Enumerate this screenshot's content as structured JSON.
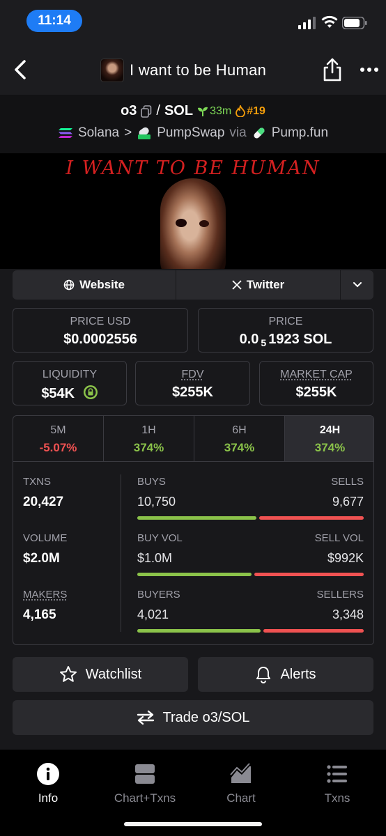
{
  "status": {
    "time": "11:14"
  },
  "nav": {
    "title": "I want to be Human"
  },
  "pair": {
    "base": "o3",
    "separator": "/",
    "quote": "SOL",
    "age": "33m",
    "rank": "#19",
    "chain": "Solana",
    "chevron": ">",
    "dex": "PumpSwap",
    "via": "via",
    "launchpad": "Pump.fun"
  },
  "banner": {
    "title": "I WANT TO BE HUMAN"
  },
  "links": {
    "website": "Website",
    "twitter": "Twitter"
  },
  "cards": {
    "price_usd": {
      "label": "PRICE USD",
      "value": "$0.0002556"
    },
    "price": {
      "label": "PRICE",
      "prefix": "0.0",
      "sub": "5",
      "suffix": "1923 SOL"
    },
    "liquidity": {
      "label": "LIQUIDITY",
      "value": "$54K"
    },
    "fdv": {
      "label": "FDV",
      "value": "$255K"
    },
    "market_cap": {
      "label": "MARKET CAP",
      "value": "$255K"
    }
  },
  "timeframes": [
    {
      "label": "5M",
      "value": "-5.07%"
    },
    {
      "label": "1H",
      "value": "374%"
    },
    {
      "label": "6H",
      "value": "374%"
    },
    {
      "label": "24H",
      "value": "374%"
    }
  ],
  "stats": {
    "txns": {
      "label": "TXNS",
      "value": "20,427"
    },
    "buys": {
      "label": "BUYS",
      "value": "10,750"
    },
    "sells": {
      "label": "SELLS",
      "value": "9,677"
    },
    "buys_fraction": 0.526,
    "volume": {
      "label": "VOLUME",
      "value": "$2.0M"
    },
    "buy_vol": {
      "label": "BUY VOL",
      "value": "$1.0M"
    },
    "sell_vol": {
      "label": "SELL VOL",
      "value": "$992K"
    },
    "buy_vol_fraction": 0.505,
    "makers": {
      "label": "MAKERS",
      "value": "4,165"
    },
    "buyers": {
      "label": "BUYERS",
      "value": "4,021"
    },
    "sellers": {
      "label": "SELLERS",
      "value": "3,348"
    },
    "buyers_fraction": 0.546
  },
  "actions": {
    "watchlist": "Watchlist",
    "alerts": "Alerts",
    "trade": "Trade o3/SOL"
  },
  "tabbar": {
    "items": [
      {
        "label": "Info",
        "icon": "info-icon",
        "active": true
      },
      {
        "label": "Chart+Txns",
        "icon": "split-view-icon",
        "active": false
      },
      {
        "label": "Chart",
        "icon": "area-chart-icon",
        "active": false
      },
      {
        "label": "Txns",
        "icon": "list-icon",
        "active": false
      }
    ]
  },
  "colors": {
    "accent": "#1e7cf5",
    "positive": "#8bc34a",
    "negative": "#f05252",
    "rank": "#f59e0b"
  }
}
